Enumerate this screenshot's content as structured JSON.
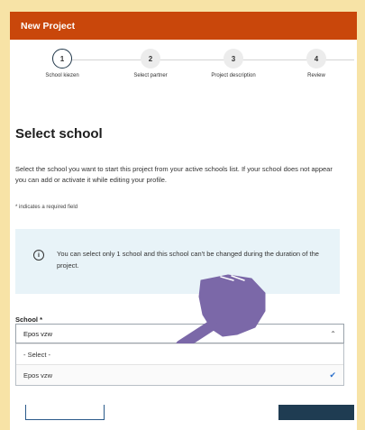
{
  "header": {
    "title": "New Project"
  },
  "stepper": {
    "steps": [
      {
        "number": "1",
        "label": "School kiezen"
      },
      {
        "number": "2",
        "label": "Select partner"
      },
      {
        "number": "3",
        "label": "Project description"
      },
      {
        "number": "4",
        "label": "Review"
      }
    ],
    "active_step": 1
  },
  "main": {
    "title": "Select school",
    "intro": "Select the school you want to start this project from your active schools list. If your school does not appear you can add or activate it while editing your profile.",
    "required_note": "* indicates a required field",
    "info": {
      "icon": "info-icon",
      "glyph": "i",
      "text": "You can select only 1 school and this school can't be changed during the duration of the project."
    },
    "school_field": {
      "label": "School *",
      "value": "Epos vzw",
      "options": [
        {
          "label": "- Select -",
          "selected": false
        },
        {
          "label": "Epos vzw",
          "selected": true
        }
      ]
    }
  },
  "colors": {
    "background": "#f7e3a6",
    "header": "#c9470b",
    "info_box": "#e8f3f8",
    "primary": "#1f3c52",
    "check": "#2a6fcb",
    "hand": "#7b68a8"
  }
}
